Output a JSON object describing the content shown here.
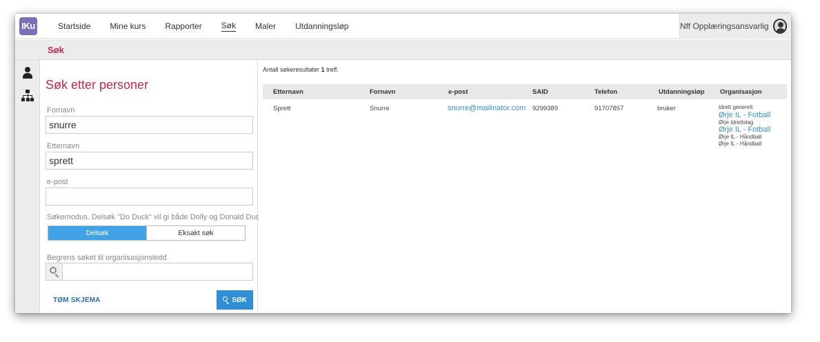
{
  "app": {
    "logo_text": "IKu"
  },
  "nav": {
    "items": [
      {
        "label": "Startside"
      },
      {
        "label": "Mine kurs"
      },
      {
        "label": "Rapporter"
      },
      {
        "label": "Søk",
        "active": true
      },
      {
        "label": "Maler"
      },
      {
        "label": "Utdanningsløp"
      }
    ],
    "user": "Nff Opplæringsansvarlig"
  },
  "subheader": {
    "title": "Søk"
  },
  "rail": {
    "icons": [
      "person-icon",
      "sitemap-icon"
    ]
  },
  "search": {
    "title": "Søk etter personer",
    "fornavn_label": "Fornavn",
    "fornavn_value": "snurre",
    "etternavn_label": "Etternavn",
    "etternavn_value": "sprett",
    "epost_label": "e-post",
    "epost_value": "",
    "mode_label": "Søkemodus. Delsøk \"Do Duck\" vil gi både Dolly og Donald Duck",
    "mode_partial": "Delsøk",
    "mode_exact": "Eksakt søk",
    "mode_selected": "Delsøk",
    "org_label": "Begrens søket til organisasjonsledd",
    "org_value": "",
    "clear_label": "TØM SKJEMA",
    "search_label": "SØK"
  },
  "results": {
    "count_prefix": "Antall søkeresultater",
    "count": "1",
    "count_suffix": "treff.",
    "columns": [
      "Etternavn",
      "Fornavn",
      "e-post",
      "SAID",
      "Telefon",
      "Utdanningsløp",
      "Organisasjon"
    ],
    "rows": [
      {
        "etternavn": "Sprett",
        "fornavn": "Snurre",
        "epost": "snurre@mailinator.com",
        "said": "9299389",
        "telefon": "91707857",
        "utdanningslop": "bruker",
        "organisasjon": [
          {
            "text": "Idrett generelt",
            "link": false
          },
          {
            "text": "Ørje IL - Fotball",
            "link": true
          },
          {
            "text": "Ørje Idrettslag",
            "link": false
          },
          {
            "text": "Ørje IL - Fotball",
            "link": true
          },
          {
            "text": "Ørje IL - Håndball",
            "link": false
          },
          {
            "text": "Ørje IL - Håndball",
            "link": false
          }
        ]
      }
    ]
  },
  "colors": {
    "accent": "#c0294f",
    "primary": "#2f8fd6",
    "logo": "#7b6fb8"
  }
}
